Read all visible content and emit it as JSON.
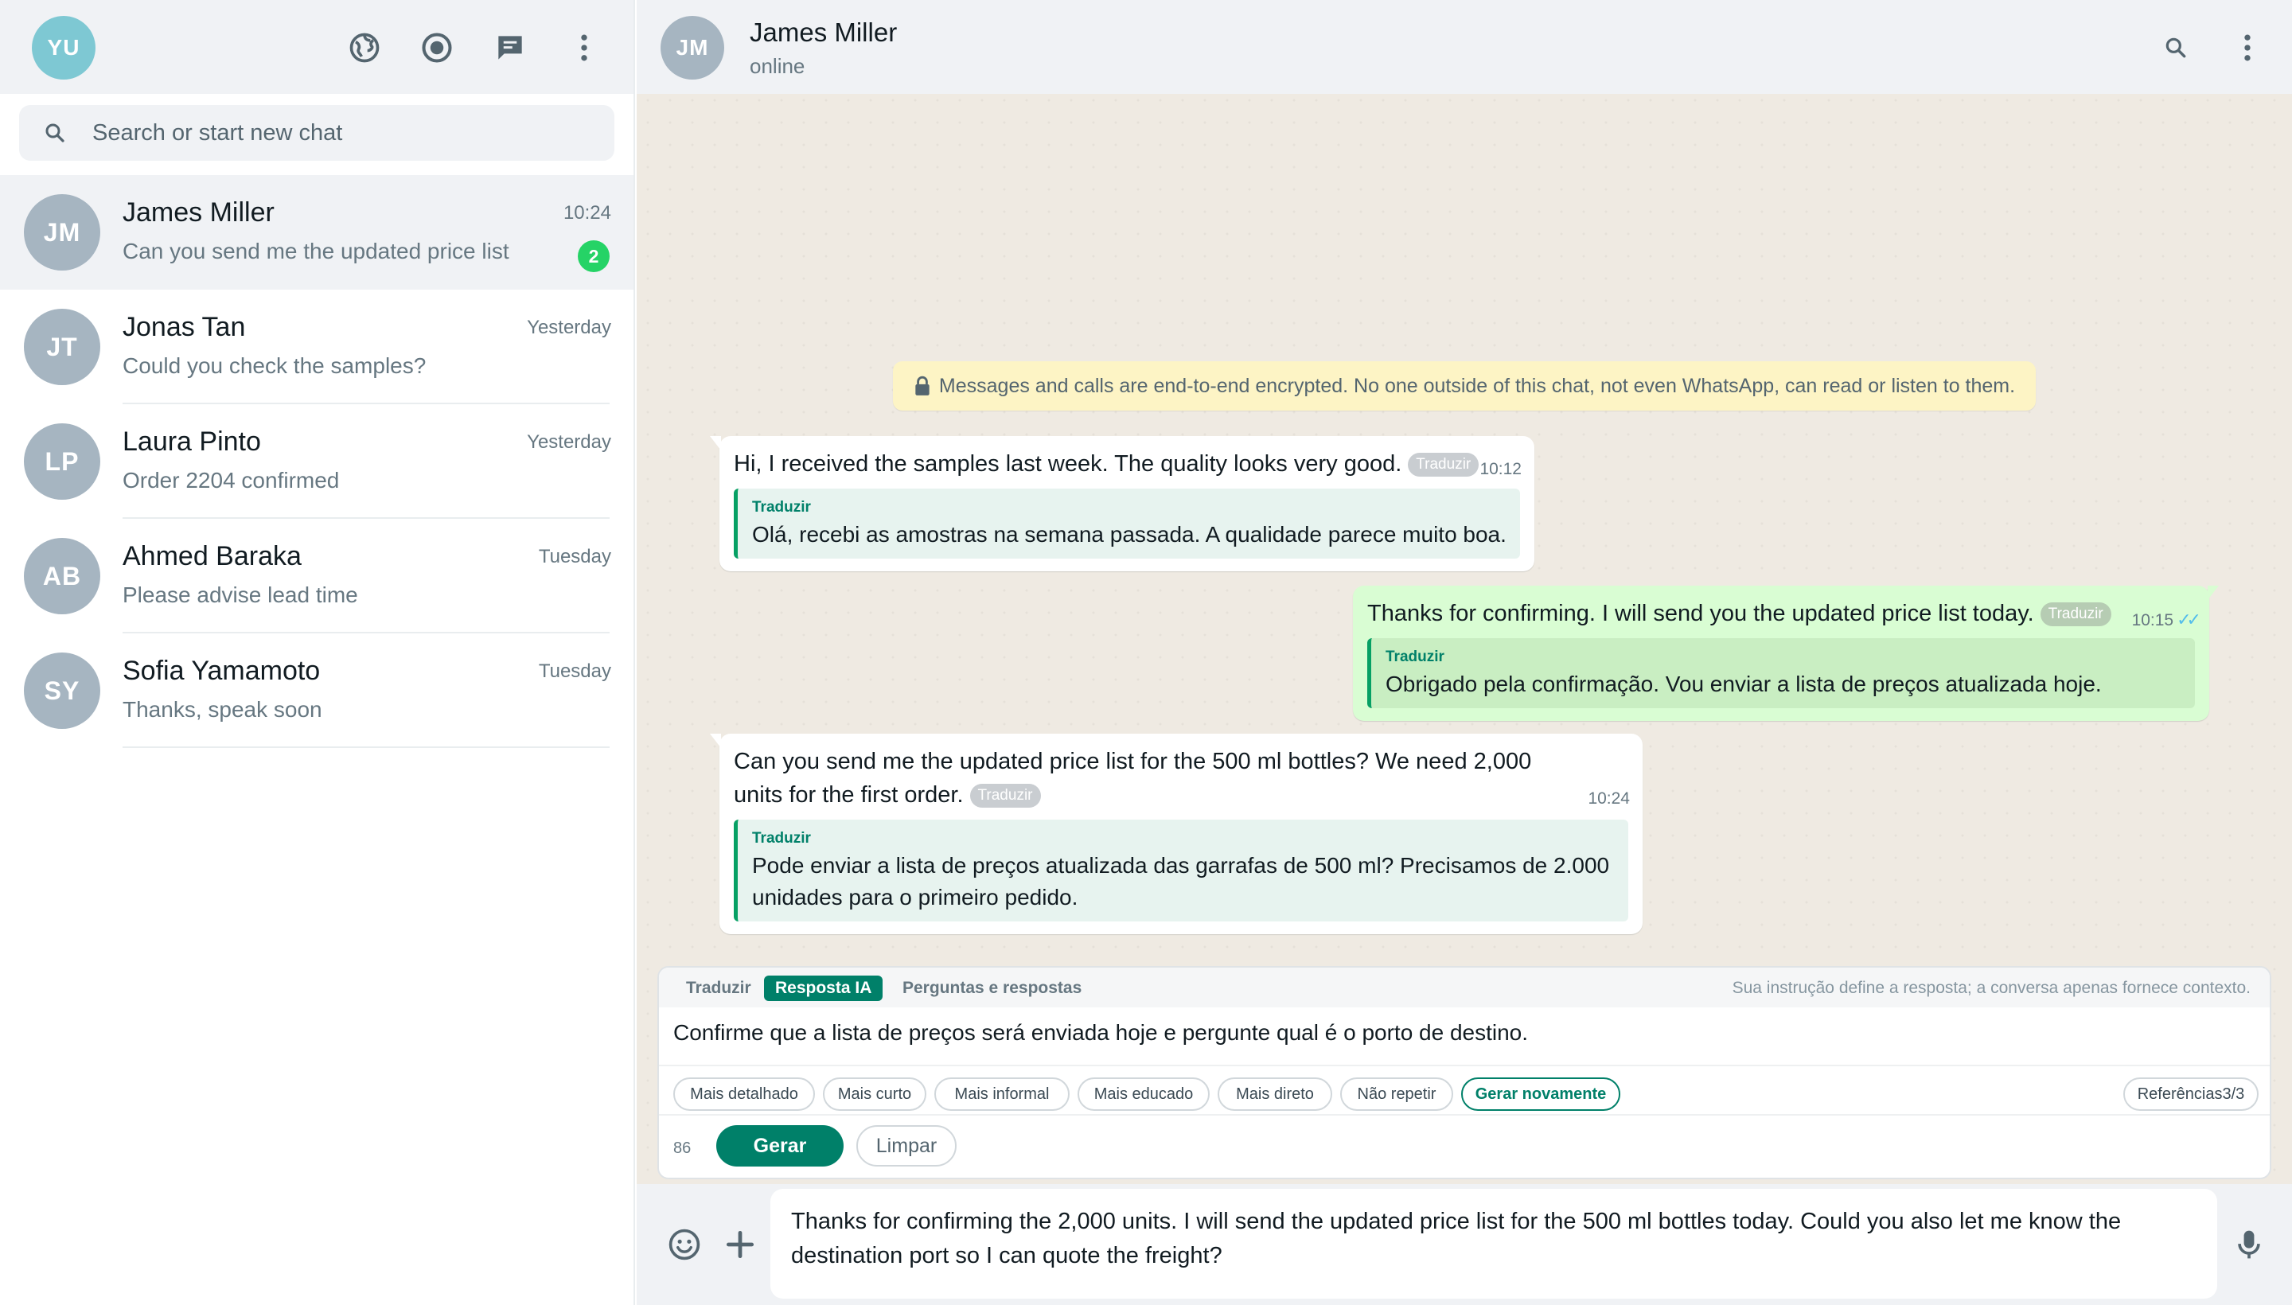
{
  "user": {
    "initials": "YU"
  },
  "search": {
    "placeholder": "Search or start new chat"
  },
  "chats": [
    {
      "initials": "JM",
      "name": "James Miller",
      "preview": "Can you send me the updated price list",
      "time": "10:24",
      "unread": "2"
    },
    {
      "initials": "JT",
      "name": "Jonas Tan",
      "preview": "Could you check the samples?",
      "time": "Yesterday"
    },
    {
      "initials": "LP",
      "name": "Laura Pinto",
      "preview": "Order 2204 confirmed",
      "time": "Yesterday"
    },
    {
      "initials": "AB",
      "name": "Ahmed Baraka",
      "preview": "Please advise lead time",
      "time": "Tuesday"
    },
    {
      "initials": "SY",
      "name": "Sofia Yamamoto",
      "preview": "Thanks, speak soon",
      "time": "Tuesday"
    }
  ],
  "conversation": {
    "contact": {
      "initials": "JM",
      "name": "James Miller",
      "status": "online"
    },
    "encryption_note": "Messages and calls are end-to-end encrypted. No one outside of this chat, not even WhatsApp, can read or listen to them.",
    "messages": [
      {
        "direction": "in",
        "text": "Hi, I received the samples last week. The quality looks very good.",
        "translate_label": "Traduzir",
        "time": "10:12",
        "translation_label": "Traduzir",
        "translation": "Olá, recebi as amostras na semana passada. A qualidade parece muito boa."
      },
      {
        "direction": "out",
        "text": "Thanks for confirming. I will send you the updated price list today.",
        "translate_label": "Traduzir",
        "time": "10:15",
        "ticks": "✓✓",
        "translation_label": "Traduzir",
        "translation": "Obrigado pela confirmação. Vou enviar a lista de preços atualizada hoje."
      },
      {
        "direction": "in",
        "text": "Can you send me the updated price list for the 500 ml bottles? We need 2,000 units for the first order.",
        "translate_label": "Traduzir",
        "time": "10:24",
        "translation_label": "Traduzir",
        "translation": "Pode enviar a lista de preços atualizada das garrafas de 500 ml? Precisamos de 2.000 unidades para o primeiro pedido."
      }
    ]
  },
  "ai_panel": {
    "tabs": [
      "Traduzir",
      "Resposta IA",
      "Perguntas e respostas"
    ],
    "active_tab": "Resposta IA",
    "hint": "Sua instrução define a resposta; a conversa apenas fornece contexto.",
    "instruction": "Confirme que a lista de preços será enviada hoje e pergunte qual é o porto de destino.",
    "chips": [
      "Mais detalhado",
      "Mais curto",
      "Mais informal",
      "Mais educado",
      "Mais direto",
      "Não repetir",
      "Gerar novamente"
    ],
    "references": "Referências3/3",
    "char_count": "86",
    "generate_label": "Gerar",
    "clear_label": "Limpar"
  },
  "composer": {
    "text": "Thanks for confirming the 2,000 units. I will send the updated price list for the 500 ml bottles today. Could you also let me know the destination port so I can quote the freight?"
  },
  "icons": {
    "sidebar_header": [
      "communities-icon",
      "status-icon",
      "new-chat-icon",
      "menu-icon"
    ],
    "conversation_header": [
      "search-icon",
      "menu-icon"
    ],
    "composer": [
      "emoji-icon",
      "attach-icon",
      "mic-icon"
    ]
  },
  "colors": {
    "accent": "#008069",
    "unread_badge": "#25d366",
    "outgoing_bubble": "#d9fdd3",
    "chat_background": "#efeae2",
    "read_ticks": "#53bdeb"
  }
}
